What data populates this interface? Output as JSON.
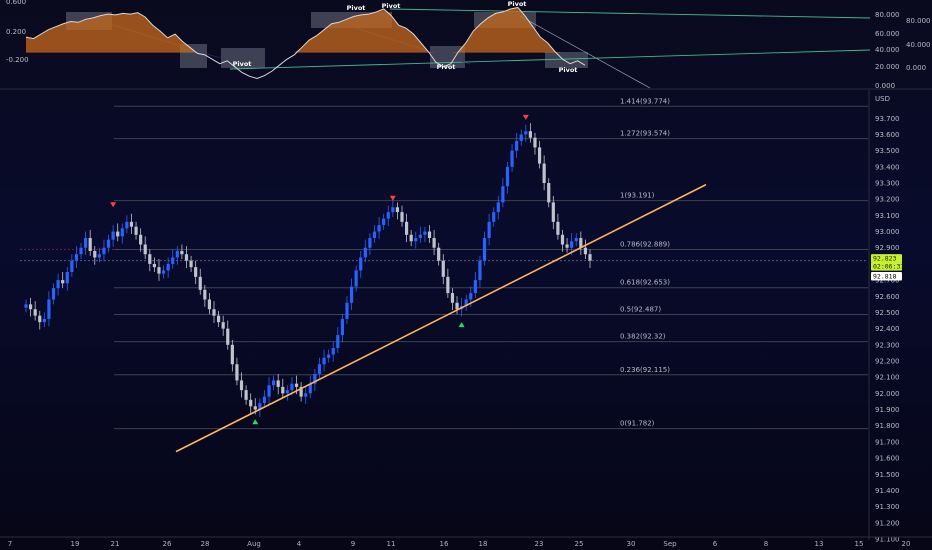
{
  "colors": {
    "bull": "#2962ff",
    "bear": "#bfc3cc",
    "trendline": "#ffb35c",
    "fib_line": "#3c4250",
    "osc_line": "#d8d8d8",
    "osc_fill": "#c8691b",
    "osc_channel": "#3fb98f",
    "price_highlight": "#c6f032",
    "marker_up": "#22dd66",
    "marker_down": "#ff4040"
  },
  "oscillator": {
    "left_axis_labels": [
      "0.600",
      "0.200",
      "-0.200"
    ],
    "right_axis_labels_outer": [
      "80.000",
      "60.000",
      "40.000",
      "20.000",
      "0.000"
    ],
    "right_axis_labels_inner": [
      "80.000",
      "40.000",
      "0.000"
    ],
    "pivot_label": "Pivot",
    "series": [
      0.26,
      0.24,
      0.3,
      0.36,
      0.4,
      0.44,
      0.47,
      0.46,
      0.5,
      0.52,
      0.55,
      0.57,
      0.56,
      0.58,
      0.57,
      0.59,
      0.53,
      0.42,
      0.34,
      0.25,
      0.3,
      0.2,
      0.12,
      0.04,
      0.02,
      -0.04,
      -0.1,
      -0.06,
      -0.14,
      -0.22,
      -0.27,
      -0.3,
      -0.26,
      -0.2,
      -0.12,
      -0.04,
      0.02,
      0.12,
      0.22,
      0.28,
      0.36,
      0.44,
      0.46,
      0.5,
      0.54,
      0.56,
      0.57,
      0.6,
      0.64,
      0.55,
      0.42,
      0.38,
      0.3,
      0.18,
      0.06,
      -0.08,
      -0.14,
      -0.1,
      0.06,
      0.18,
      0.34,
      0.44,
      0.52,
      0.58,
      0.6,
      0.64,
      0.66,
      0.54,
      0.4,
      0.26,
      0.18,
      0.06,
      -0.04,
      -0.1,
      -0.06,
      -0.12
    ]
  },
  "chart_data": {
    "type": "candlestick",
    "currency_label": "USD",
    "y_axis": {
      "ylim": [
        91.1,
        93.85
      ],
      "ticks": [
        "93.700",
        "93.600",
        "93.500",
        "93.400",
        "93.300",
        "93.200",
        "93.100",
        "93.000",
        "92.900",
        "92.800",
        "92.700",
        "92.600",
        "92.500",
        "92.400",
        "92.300",
        "92.200",
        "92.100",
        "92.000",
        "91.900",
        "91.800",
        "91.700",
        "91.600",
        "91.500",
        "91.400",
        "91.300",
        "91.200",
        "91.100"
      ]
    },
    "x_axis": {
      "labels": [
        "7",
        "19",
        "21",
        "26",
        "28",
        "Aug",
        "4",
        "9",
        "11",
        "16",
        "18",
        "23",
        "25",
        "30",
        "Sep",
        "6",
        "8",
        "13",
        "15",
        "20"
      ]
    },
    "fibonacci": [
      {
        "level": "1.414",
        "price": 93.774,
        "label": "1.414(93.774)"
      },
      {
        "level": "1.272",
        "price": 93.574,
        "label": "1.272(93.574)"
      },
      {
        "level": "1",
        "price": 93.191,
        "label": "1(93.191)"
      },
      {
        "level": "0.786",
        "price": 92.889,
        "label": "0.786(92.889)"
      },
      {
        "level": "0.618",
        "price": 92.653,
        "label": "0.618(92.653)"
      },
      {
        "level": "0.5",
        "price": 92.487,
        "label": "0.5(92.487)"
      },
      {
        "level": "0.382",
        "price": 92.32,
        "label": "0.382(92.32)"
      },
      {
        "level": "0.236",
        "price": 92.115,
        "label": "0.236(92.115)"
      },
      {
        "level": "0",
        "price": 91.782,
        "label": "0(91.782)"
      }
    ],
    "trendline": {
      "start": [
        91.64
      ],
      "end": [
        93.29
      ]
    },
    "price_tags": [
      {
        "label": "92.823",
        "style": "highlight"
      },
      {
        "label": "02:06:37",
        "style": "highlight"
      },
      {
        "label": "92.818",
        "style": "white"
      }
    ],
    "current_price": 92.82,
    "closes": [
      92.55,
      92.52,
      92.48,
      92.44,
      92.46,
      92.58,
      92.65,
      92.7,
      92.68,
      92.75,
      92.82,
      92.86,
      92.9,
      92.96,
      92.88,
      92.84,
      92.86,
      92.9,
      92.95,
      93.0,
      92.97,
      93.02,
      93.06,
      93.03,
      92.98,
      92.92,
      92.86,
      92.8,
      92.78,
      92.74,
      92.76,
      92.8,
      92.84,
      92.88,
      92.86,
      92.82,
      92.78,
      92.72,
      92.64,
      92.58,
      92.52,
      92.48,
      92.44,
      92.4,
      92.3,
      92.18,
      92.08,
      92.02,
      91.96,
      91.92,
      91.9,
      91.94,
      91.98,
      92.05,
      92.08,
      92.04,
      92.0,
      92.02,
      92.06,
      92.04,
      91.98,
      92.0,
      92.06,
      92.12,
      92.18,
      92.22,
      92.24,
      92.28,
      92.36,
      92.46,
      92.56,
      92.66,
      92.76,
      92.84,
      92.9,
      92.96,
      93.0,
      93.04,
      93.08,
      93.12,
      93.15,
      93.12,
      93.06,
      92.98,
      92.94,
      92.96,
      92.98,
      93.0,
      92.96,
      92.9,
      92.82,
      92.72,
      92.62,
      92.56,
      92.52,
      92.54,
      92.58,
      92.62,
      92.7,
      92.82,
      92.96,
      93.06,
      93.12,
      93.18,
      93.28,
      93.4,
      93.5,
      93.56,
      93.6,
      93.62,
      93.58,
      93.52,
      93.42,
      93.3,
      93.18,
      93.06,
      92.98,
      92.92,
      92.9,
      92.94,
      92.96,
      92.9,
      92.86,
      92.82
    ],
    "markers": [
      {
        "type": "down",
        "bar": 19,
        "price": 93.15
      },
      {
        "type": "up",
        "bar": 50,
        "price": 91.84
      },
      {
        "type": "down",
        "bar": 80,
        "price": 93.19
      },
      {
        "type": "up",
        "bar": 95,
        "price": 92.44
      },
      {
        "type": "down",
        "bar": 109,
        "price": 93.69
      }
    ]
  }
}
